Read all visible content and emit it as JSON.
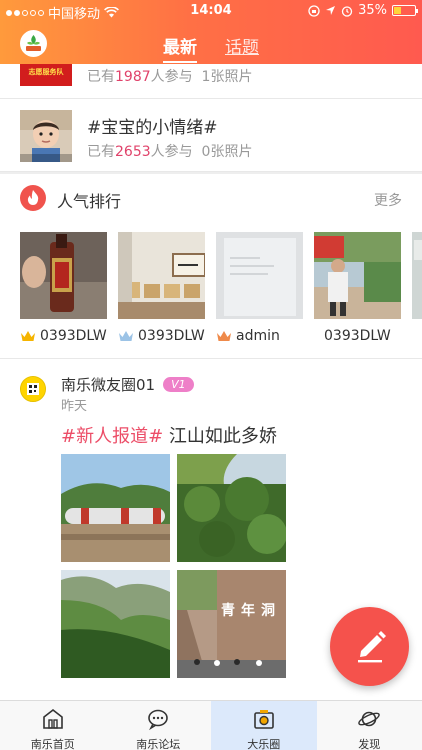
{
  "status_bar": {
    "carrier": "中国移动",
    "time": "14:04",
    "battery": "35%",
    "battery_level": 0.35
  },
  "header": {
    "tabs": [
      {
        "label": "最新",
        "active": true
      },
      {
        "label": "话题",
        "active": false
      }
    ]
  },
  "topics": [
    {
      "title": "",
      "thumb_text": "志愿服务队",
      "participants_prefix": "已有",
      "participants": "1987",
      "participants_suffix": "人参与",
      "photos": "1张照片"
    },
    {
      "title": "#宝宝的小情绪#",
      "participants_prefix": "已有",
      "participants": "2653",
      "participants_suffix": "人参与",
      "photos": "0张照片"
    }
  ],
  "ranking": {
    "title": "人气排行",
    "more": "更多",
    "users": [
      {
        "name": "0393DLW",
        "crown": "gold"
      },
      {
        "name": "0393DLW",
        "crown": "silver"
      },
      {
        "name": "admin",
        "crown": "bronze"
      },
      {
        "name": "0393DLW",
        "crown": "none"
      }
    ]
  },
  "post": {
    "author": "南乐微友圈01",
    "badge": "V1",
    "time": "昨天",
    "tag": "#新人报道#",
    "text": " 江山如此多娇",
    "photo_caption": "青年洞"
  },
  "bottom_nav": [
    {
      "label": "南乐首页",
      "icon": "home-icon",
      "active": false
    },
    {
      "label": "南乐论坛",
      "icon": "forum-icon",
      "active": false
    },
    {
      "label": "大乐圈",
      "icon": "camera-icon",
      "active": true
    },
    {
      "label": "发现",
      "icon": "planet-icon",
      "active": false
    }
  ],
  "colors": {
    "header_start": "#ff9a3c",
    "header_end": "#ff5a4f",
    "accent": "#ec4e68",
    "fab": "#f5524c"
  }
}
